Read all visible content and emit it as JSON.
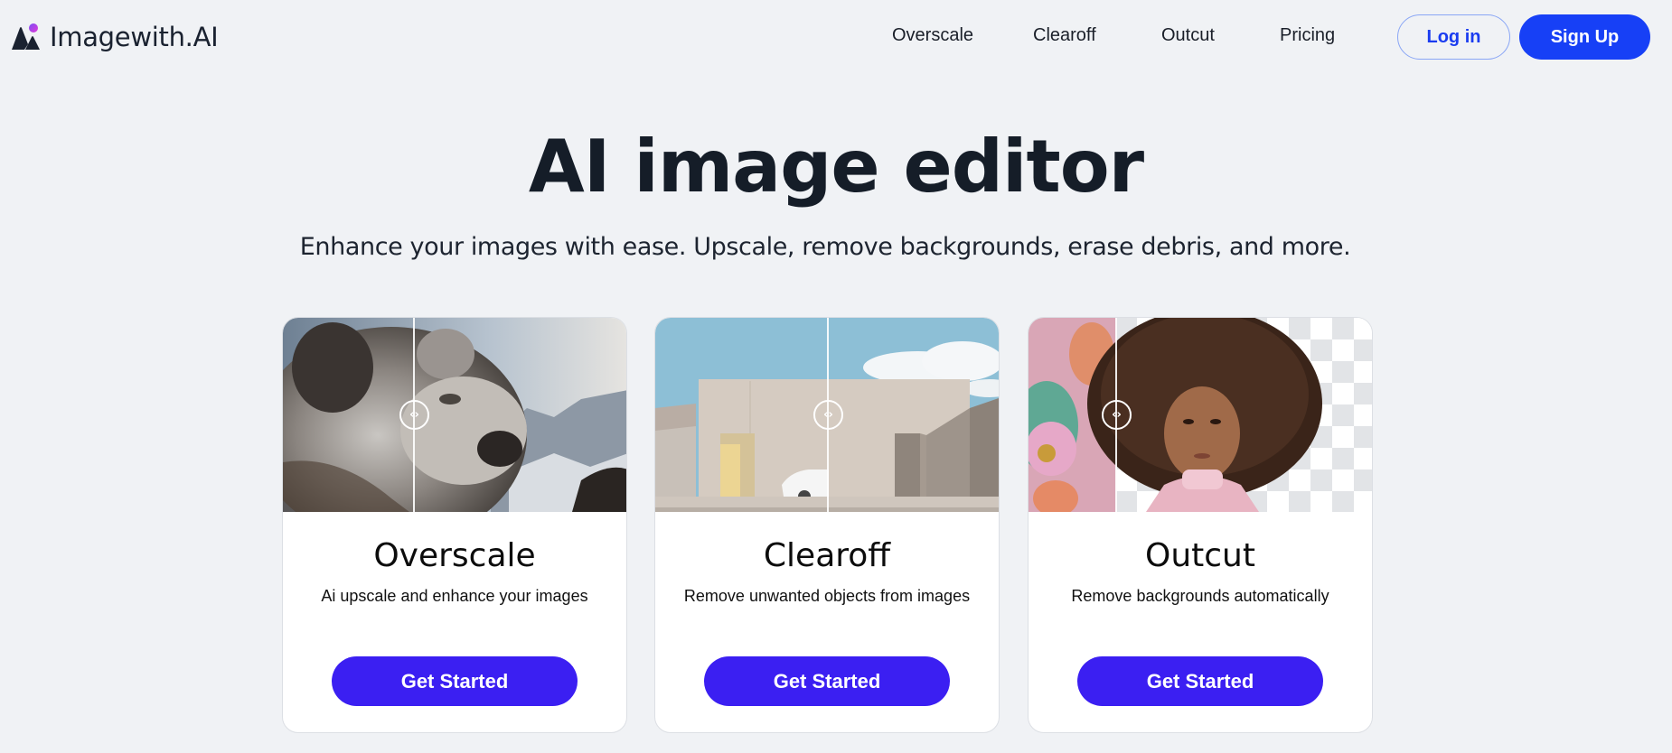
{
  "brand": {
    "name": "Imagewith.AI",
    "logo_icon": "mountain-dot-logo",
    "accent_dot_colors": [
      "#d63ee6",
      "#7a4cf5"
    ]
  },
  "nav": {
    "links": [
      {
        "label": "Overscale"
      },
      {
        "label": "Clearoff"
      },
      {
        "label": "Outcut"
      },
      {
        "label": "Pricing"
      }
    ],
    "login_label": "Log in",
    "signup_label": "Sign Up"
  },
  "hero": {
    "title": "AI image editor",
    "subtitle": "Enhance your images with ease. Upscale, remove backgrounds, erase debris, and more."
  },
  "cards": [
    {
      "title": "Overscale",
      "description": "Ai upscale and enhance your images",
      "button_label": "Get Started",
      "image_subject": "snow leopard cub before/after upscale comparison",
      "compare_handle_icon": "chevron-left-right-icon",
      "compare_position": 0.38
    },
    {
      "title": "Clearoff",
      "description": "Remove unwanted objects from images",
      "button_label": "Get Started",
      "image_subject": "building with car before/after object removal comparison",
      "compare_handle_icon": "chevron-left-right-icon",
      "compare_position": 0.5
    },
    {
      "title": "Outcut",
      "description": "Remove backgrounds automatically",
      "button_label": "Get Started",
      "image_subject": "portrait with background removed to transparency checkerboard",
      "compare_handle_icon": "chevron-left-right-icon",
      "compare_position": 0.25
    }
  ],
  "handle_glyph": "‹›",
  "colors": {
    "page_bg": "#f0f2f5",
    "primary_button": "#3b1ff2",
    "signup_button": "#1740f6",
    "login_text": "#1a3cf0",
    "login_border": "#8aa6f5"
  }
}
